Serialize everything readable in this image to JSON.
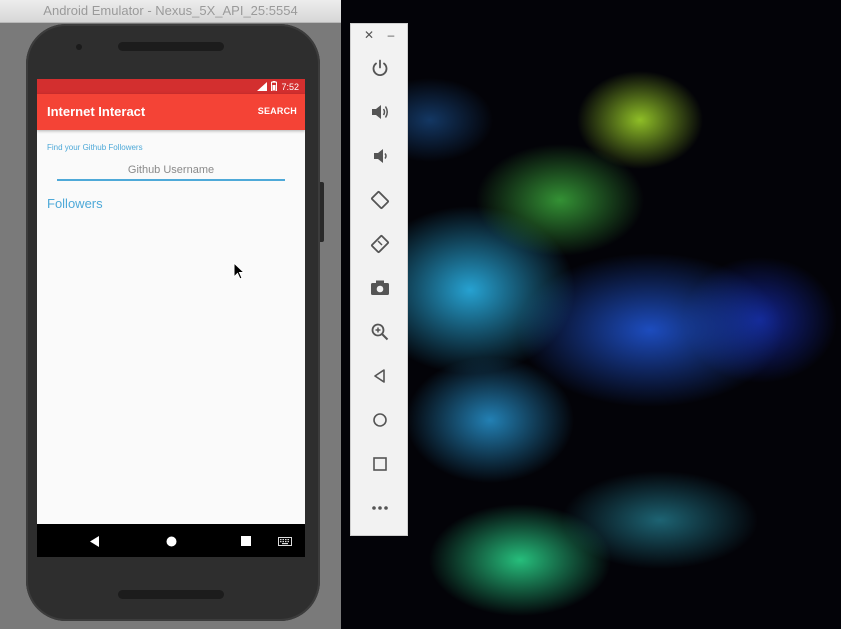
{
  "window": {
    "title": "Android Emulator - Nexus_5X_API_25:5554"
  },
  "statusbar": {
    "time": "7:52",
    "icons": [
      "signal-icon",
      "battery-icon"
    ]
  },
  "appbar": {
    "title": "Internet Interact",
    "action_label": "SEARCH"
  },
  "form": {
    "prompt_label": "Find your Github Followers",
    "username_placeholder": "Github Username",
    "username_value": ""
  },
  "followers": {
    "heading": "Followers",
    "items": []
  },
  "navbar": {
    "buttons": [
      "back-icon",
      "home-icon",
      "recents-icon",
      "keyboard-icon"
    ]
  },
  "toolbar": {
    "buttons": [
      "power-icon",
      "volume-up-icon",
      "volume-down-icon",
      "rotate-left-icon",
      "rotate-right-icon",
      "camera-icon",
      "zoom-icon",
      "back-icon",
      "home-icon",
      "overview-icon",
      "more-icon"
    ]
  },
  "colors": {
    "statusbar": "#d32f2f",
    "appbar": "#f44336",
    "accent": "#4ea9d8",
    "screen_bg": "#fafafa"
  }
}
